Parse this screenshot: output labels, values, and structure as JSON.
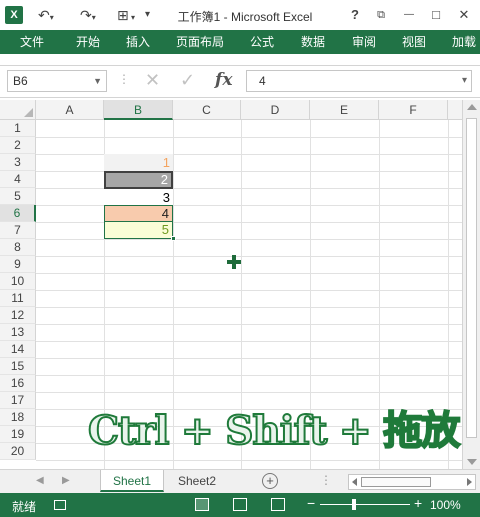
{
  "titlebar": {
    "app_icon": "X",
    "title": "工作簿1 - Microsoft Excel",
    "icons": [
      "excel-logo-icon",
      "undo-icon",
      "redo-icon",
      "customize-quick-access-icon",
      "help-icon",
      "ribbon-display-icon",
      "minimize-icon",
      "maximize-icon",
      "close-icon"
    ],
    "help": "?",
    "minimize": "—",
    "maximize": "□",
    "close": "✕"
  },
  "ribbon": {
    "tabs": [
      "文件",
      "开始",
      "插入",
      "页面布局",
      "公式",
      "数据",
      "审阅",
      "视图",
      "加载"
    ]
  },
  "formula_bar": {
    "name_box": "B6",
    "cancel": "✕",
    "enter": "✓",
    "fx": "fx",
    "formula": "4"
  },
  "grid": {
    "columns": [
      "A",
      "B",
      "C",
      "D",
      "E",
      "F"
    ],
    "selected_column": "B",
    "rows": [
      "1",
      "2",
      "3",
      "4",
      "5",
      "6",
      "7",
      "8",
      "9",
      "10",
      "11",
      "12",
      "13",
      "14",
      "15",
      "16",
      "17",
      "18",
      "19",
      "20"
    ],
    "selected_row": "6",
    "cells": [
      {
        "ref": "B3",
        "value": "1"
      },
      {
        "ref": "B4",
        "value": "2"
      },
      {
        "ref": "B5",
        "value": "3"
      },
      {
        "ref": "B6",
        "value": "4"
      },
      {
        "ref": "B7",
        "value": "5"
      }
    ]
  },
  "overlay_text": "Ctrl + Shift + 拖放",
  "sheets": {
    "tabs": [
      "Sheet1",
      "Sheet2"
    ],
    "active": "Sheet1",
    "add": "+"
  },
  "statusbar": {
    "status": "就绪",
    "zoom": "100%",
    "zoom_minus": "−",
    "zoom_plus": "+"
  },
  "colors": {
    "excel_green": "#217346",
    "b3_text": "#f4a460",
    "b4_fill": "#a6a6a6",
    "b6_fill": "#f8cbad",
    "b7_fill": "#fafdd6"
  }
}
